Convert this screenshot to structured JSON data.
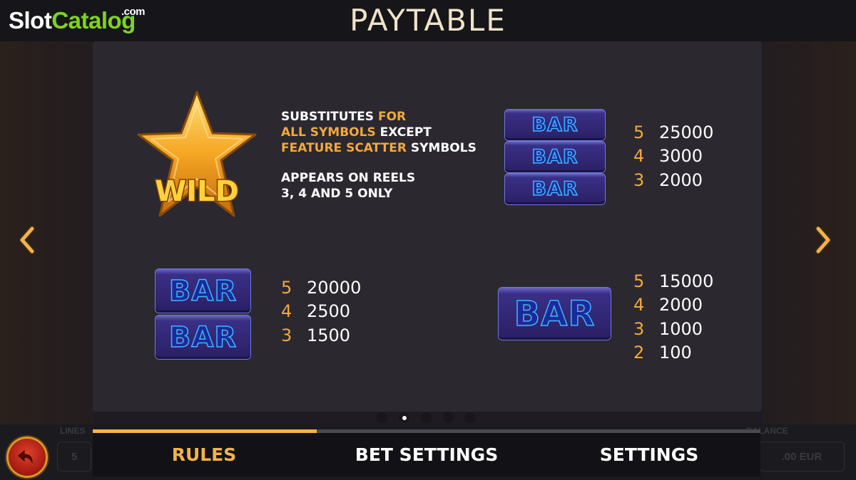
{
  "branding": {
    "logo_slot": "Slot",
    "logo_catalog": "Catalog",
    "logo_com": ".com"
  },
  "header": {
    "title": "PAYTABLE"
  },
  "wild": {
    "label": "WILD",
    "line1_a": "SUBSTITUTES",
    "line1_b": "FOR",
    "line2_a": "ALL SYMBOLS",
    "line2_b": "EXCEPT",
    "line3_a": "FEATURE SCATTER",
    "line3_b": "SYMBOLS",
    "line4": "APPEARS ON REELS",
    "line5": "3, 4 AND 5 ONLY"
  },
  "symbols": {
    "bar_label": "BAR",
    "triple_bar": [
      {
        "count": "5",
        "value": "25000"
      },
      {
        "count": "4",
        "value": "3000"
      },
      {
        "count": "3",
        "value": "2000"
      }
    ],
    "double_bar": [
      {
        "count": "5",
        "value": "20000"
      },
      {
        "count": "4",
        "value": "2500"
      },
      {
        "count": "3",
        "value": "1500"
      }
    ],
    "single_bar": [
      {
        "count": "5",
        "value": "15000"
      },
      {
        "count": "4",
        "value": "2000"
      },
      {
        "count": "3",
        "value": "1000"
      },
      {
        "count": "2",
        "value": "100"
      }
    ]
  },
  "pagination": {
    "pages": 5,
    "active_index": 1
  },
  "background_hud": {
    "lines_label": "LINES",
    "lines_value": "5",
    "balance_label": "BALANCE",
    "balance_value": ".00 EUR"
  },
  "tabs": {
    "rules": "RULES",
    "bet_settings": "BET SETTINGS",
    "settings": "SETTINGS",
    "active": "rules",
    "progress_fraction": 0.335
  },
  "colors": {
    "accent": "#f2a93b",
    "tab_active": "#f2b24b",
    "logo_green": "#7ed321",
    "bar_outline": "#3fb6ff"
  },
  "icons": {
    "back": "back-arrow-icon",
    "prev": "chevron-left-icon",
    "next": "chevron-right-icon"
  }
}
